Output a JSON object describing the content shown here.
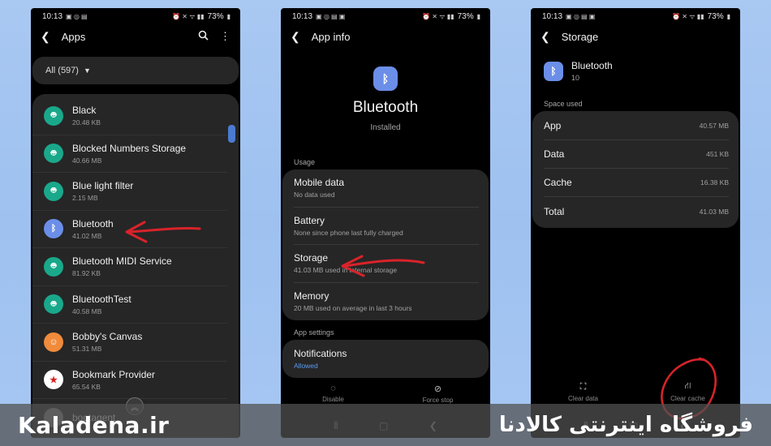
{
  "status": {
    "p1": {
      "time": "10:13",
      "battery": "73%"
    },
    "p2": {
      "time": "10:13",
      "battery": "73%"
    },
    "p3": {
      "time": "10:13",
      "battery": "73%"
    }
  },
  "apps": {
    "title": "Apps",
    "filter": "All (597)",
    "items": [
      {
        "name": "Black",
        "size": "20.48 KB",
        "icon": "android-icon"
      },
      {
        "name": "Blocked Numbers Storage",
        "size": "40.66 MB",
        "icon": "android-icon"
      },
      {
        "name": "Blue light filter",
        "size": "2.15 MB",
        "icon": "android-icon"
      },
      {
        "name": "Bluetooth",
        "size": "41.02 MB",
        "icon": "bluetooth-icon"
      },
      {
        "name": "Bluetooth MIDI Service",
        "size": "81.92 KB",
        "icon": "android-icon"
      },
      {
        "name": "BluetoothTest",
        "size": "40.58 MB",
        "icon": "android-icon"
      },
      {
        "name": "Bobby's Canvas",
        "size": "51.31 MB",
        "icon": "canvas-icon"
      },
      {
        "name": "Bookmark Provider",
        "size": "65.54 KB",
        "icon": "bookmark-icon"
      },
      {
        "name": "bootagent",
        "size": "",
        "icon": "android-icon"
      }
    ]
  },
  "appinfo": {
    "title": "App info",
    "app_name": "Bluetooth",
    "status": "Installed",
    "usage_label": "Usage",
    "usage_items": [
      {
        "title": "Mobile data",
        "sub": "No data used"
      },
      {
        "title": "Battery",
        "sub": "None since phone last fully charged"
      },
      {
        "title": "Storage",
        "sub": "41.03 MB used in internal storage"
      },
      {
        "title": "Memory",
        "sub": "20 MB used on average in last 3 hours"
      }
    ],
    "settings_label": "App settings",
    "notifications": {
      "title": "Notifications",
      "sub": "Allowed"
    },
    "disable_label": "Disable",
    "force_stop_label": "Force stop"
  },
  "storage": {
    "title": "Storage",
    "app_name": "Bluetooth",
    "version": "10",
    "space_label": "Space used",
    "rows": [
      {
        "label": "App",
        "value": "40.57 MB"
      },
      {
        "label": "Data",
        "value": "451 KB"
      },
      {
        "label": "Cache",
        "value": "16.38 KB"
      },
      {
        "label": "Total",
        "value": "41.03 MB"
      }
    ],
    "clear_data_label": "Clear data",
    "clear_cache_label": "Clear cache"
  },
  "watermark": {
    "latin": "Kaladena.ir",
    "persian": "فروشگاه اینترنتی کالادنا"
  },
  "colors": {
    "background": "#a9c8f2",
    "annotation": "#d8232a",
    "accent": "#6b8ee8",
    "link": "#5b9bf0"
  }
}
